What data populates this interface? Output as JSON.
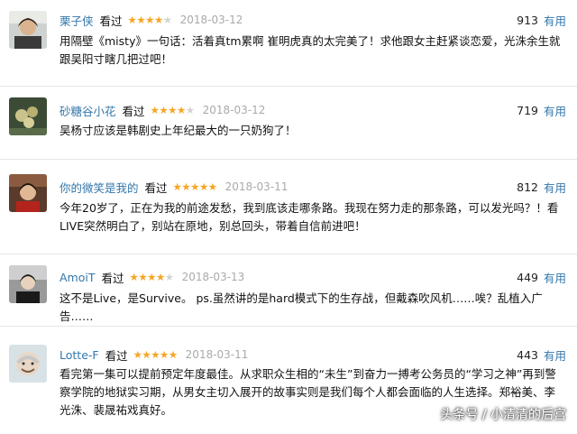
{
  "reviews": [
    {
      "user": "栗子侠",
      "watched": "看过",
      "rating": 4,
      "date": "2018-03-12",
      "votes": "913",
      "useful": "有用",
      "text": "用隔壁《misty》一句话：活着真tm累啊 崔明虎真的太完美了！求他跟女主赶紧谈恋爱，光洙余生就跟吴阳寸瞎几把过吧！"
    },
    {
      "user": "砂糖谷小花",
      "watched": "看过",
      "rating": 4,
      "date": "2018-03-12",
      "votes": "719",
      "useful": "有用",
      "text": "吴杨寸应该是韩剧史上年纪最大的一只奶狗了！"
    },
    {
      "user": "你的微笑是我的",
      "watched": "看过",
      "rating": 5,
      "date": "2018-03-11",
      "votes": "812",
      "useful": "有用",
      "text": "今年20岁了，正在为我的前途发愁，我到底该走哪条路。我现在努力走的那条路，可以发光吗？！看LIVE突然明白了，别站在原地，别总回头，带着自信前进吧！"
    },
    {
      "user": "AmoiT",
      "watched": "看过",
      "rating": 4,
      "date": "2018-03-13",
      "votes": "449",
      "useful": "有用",
      "text": "这不是Live，是Survive。 ps.虽然讲的是hard模式下的生存战，但戴森吹风机……唉？乱植入广告……"
    },
    {
      "user": "Lotte-F",
      "watched": "看过",
      "rating": 5,
      "date": "2018-03-11",
      "votes": "443",
      "useful": "有用",
      "text": "看完第一集可以提前预定年度最佳。从求职众生相的“未生”到奋力一搏考公务员的“学习之神”再到警察学院的地狱实习期，从男女主切入展开的故事实则是我们每个人都会面临的人生选择。郑裕美、李光洙、裴晟祐戏真好。"
    }
  ],
  "watermark": "头条号 / 小清清的后宫",
  "colors": {
    "link": "#3377aa",
    "star": "#f7a524",
    "date": "#aaaaaa"
  }
}
